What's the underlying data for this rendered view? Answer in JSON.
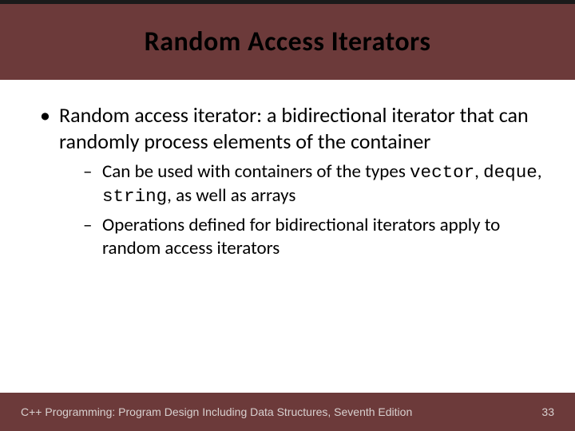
{
  "title": "Random Access Iterators",
  "bullets": {
    "item1": {
      "text": "Random access iterator: a bidirectional iterator that can randomly process elements of the container",
      "sub1": {
        "pre": "Can be used with containers of the types ",
        "code1": "vector",
        "mid1": ", ",
        "code2": "deque",
        "mid2": ", ",
        "code3": "string",
        "post": ", as well as arrays"
      },
      "sub2": "Operations defined for bidirectional iterators apply to random access iterators"
    }
  },
  "footer": {
    "book": "C++ Programming: Program Design Including Data Structures, Seventh Edition",
    "page": "33"
  }
}
